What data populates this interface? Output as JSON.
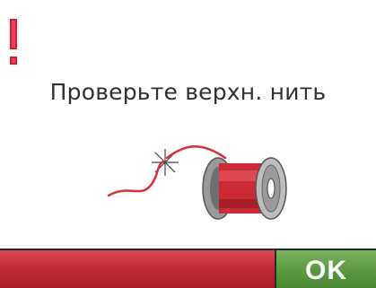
{
  "alert": {
    "icon": "exclamation-icon",
    "color": "#d21f35"
  },
  "message": "Проверьте верхн. нить",
  "illustration": {
    "icon": "thread-spool-icon",
    "thread_color": "#d8303c",
    "spool_color": "#9a9a9a"
  },
  "footer": {
    "left_panel_color": "#c12b36",
    "ok_label": "OK",
    "ok_color": "#5e9a42"
  }
}
